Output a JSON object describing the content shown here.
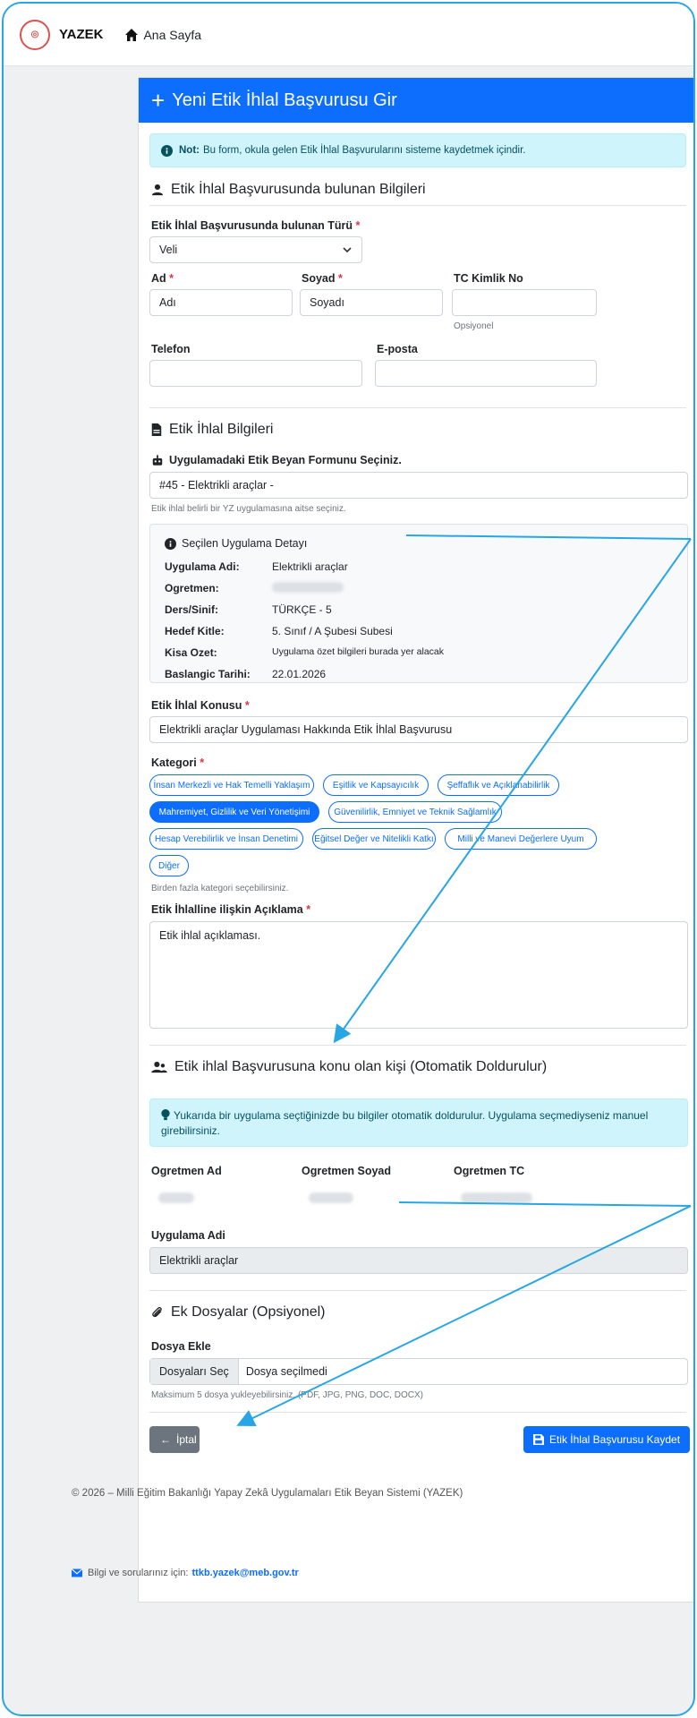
{
  "nav": {
    "brand": "YAZEK",
    "home": "Ana Sayfa"
  },
  "header": {
    "title": "Yeni Etik İhlal Başvurusu Gir"
  },
  "note": {
    "bold": "Not:",
    "text": "Bu form, okula gelen Etik İhlal Başvurularını sisteme kaydetmek içindir."
  },
  "section1": {
    "title": "Etik İhlal Başvurusunda bulunan Bilgileri",
    "type_label": "Etik İhlal Başvurusunda bulunan Türü",
    "type_value": "Veli",
    "ad_label": "Ad",
    "ad_value": "Adı",
    "soyad_label": "Soyad",
    "soyad_value": "Soyadı",
    "tc_label": "TC Kimlik No",
    "tc_hint": "Opsiyonel",
    "phone_label": "Telefon",
    "email_label": "E-posta"
  },
  "section2": {
    "title": "Etik İhlal Bilgileri",
    "form_label": "Uygulamadaki Etik Beyan Formunu Seçiniz.",
    "form_value": "#45 - Elektrikli araçlar -",
    "form_hint": "Etik ihlal belirli bir YZ uygulamasına aitse seçiniz.",
    "detail_title": "Seçilen Uygulama Detayı",
    "details": [
      {
        "k": "Uygulama Adi:",
        "v": "Elektrikli araçlar"
      },
      {
        "k": "Ogretmen:",
        "v": ""
      },
      {
        "k": "Ders/Sinif:",
        "v": "TÜRKÇE - 5"
      },
      {
        "k": "Hedef Kitle:",
        "v": "5. Sınıf / A Şubesi Subesi"
      },
      {
        "k": "Kisa Ozet:",
        "v": "Uygulama özet bilgileri burada yer alacak"
      },
      {
        "k": "Baslangic Tarihi:",
        "v": "22.01.2026"
      }
    ],
    "konu_label": "Etik İhlal Konusu",
    "konu_value": "Elektrikli araçlar Uygulaması Hakkında Etik İhlal Başvurusu",
    "kategori_label": "Kategori",
    "categories": [
      "İnsan Merkezli ve Hak Temelli Yaklaşım",
      "Eşitlik ve Kapsayıcılık",
      "Şeffaflık ve Açıklanabilirlik",
      "Mahremiyet, Gizlilik ve Veri Yönetişimi",
      "Güvenilirlik, Emniyet ve Teknik Sağlamlık",
      "Hesap Verebilirlik ve İnsan Denetimi",
      "Eğitsel Değer ve Nitelikli Katkı",
      "Milli ve Manevi Değerlere Uyum",
      "Diğer"
    ],
    "kategori_hint": "Birden fazla kategori seçebilirsiniz.",
    "aciklama_label": "Etik İhlalline ilişkin Açıklama",
    "aciklama_value": "Etik ihlal açıklaması."
  },
  "section3": {
    "title": "Etik ihlal Başvurusuna konu olan kişi (Otomatik Doldurulur)",
    "info": "Yukarıda bir uygulama seçtiğinizde bu bilgiler otomatik doldurulur. Uygulama seçmediyseniz manuel girebilirsiniz.",
    "ad_label": "Ogretmen Ad",
    "soyad_label": "Ogretmen Soyad",
    "tc_label": "Ogretmen TC",
    "app_label": "Uygulama Adi",
    "app_value": "Elektrikli araçlar"
  },
  "section4": {
    "title": "Ek Dosyalar (Opsiyonel)",
    "file_label": "Dosya Ekle",
    "file_button": "Dosyaları Seç",
    "file_status": "Dosya seçilmedi",
    "file_hint": "Maksimum 5 dosya yukleyebilirsiniz. (PDF, JPG, PNG, DOC, DOCX)"
  },
  "actions": {
    "cancel": "İptal",
    "save": "Etik İhlal Başvurusu Kaydet"
  },
  "footer": {
    "copyright": "© 2026 – Milli Eğitim Bakanlığı Yapay Zekâ Uygulamaları Etik Beyan Sistemi (YAZEK)",
    "contact_prefix": "Bilgi ve sorularınız için:",
    "contact_email": "ttkb.yazek@meb.gov.tr"
  },
  "colors": {
    "primary": "#0d6efd",
    "accent_border": "#27a6e5",
    "info_bg": "#cff4fc",
    "required": "#dc3545"
  }
}
